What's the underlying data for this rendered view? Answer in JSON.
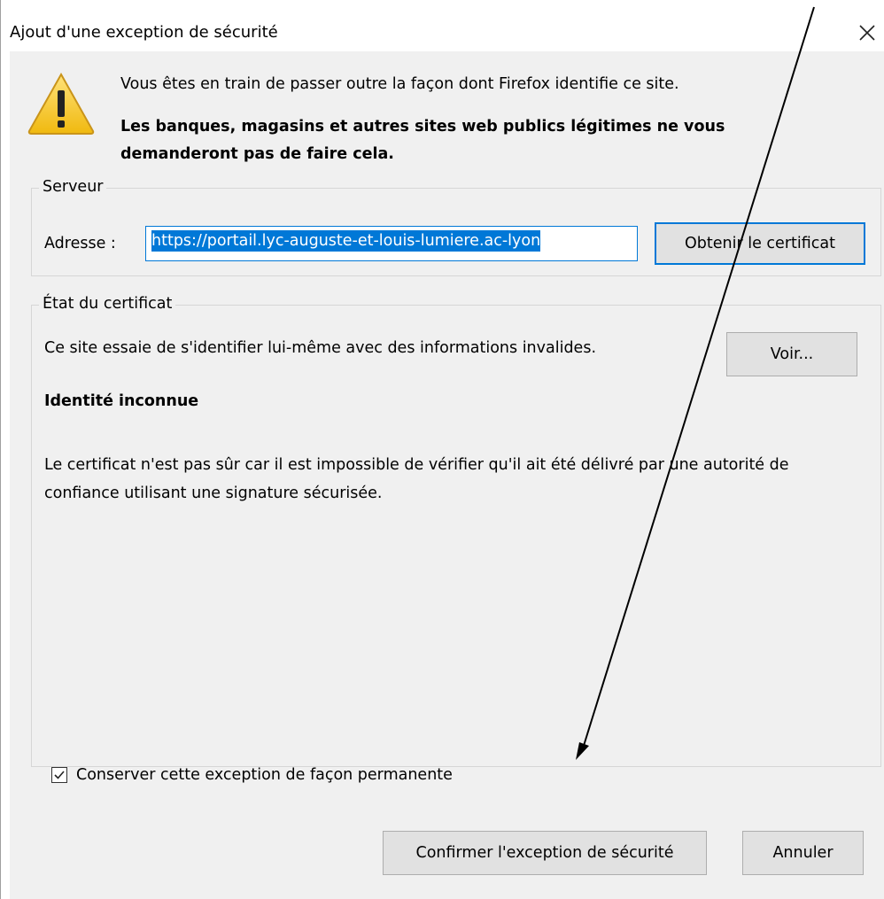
{
  "window": {
    "title": "Ajout d'une exception de sécurité",
    "close_icon": "close-icon"
  },
  "warning": {
    "icon": "warning-icon",
    "line1": "Vous êtes en train de passer outre la façon dont Firefox identifie ce site.",
    "line2": "Les banques, magasins et autres sites web publics légitimes ne vous demanderont pas de faire cela."
  },
  "server": {
    "legend": "Serveur",
    "address_label": "Adresse :",
    "address_value": "https://portail.lyc-auguste-et-louis-lumiere.ac-lyon",
    "get_cert_button": "Obtenir le certificat"
  },
  "cert_state": {
    "legend": "État du certificat",
    "status_text": "Ce site essaie de s'identifier lui-même avec des informations invalides.",
    "view_button": "Voir...",
    "identity_heading": "Identité inconnue",
    "description": "Le certificat n'est pas sûr car il est impossible de vérifier qu'il ait été délivré par une autorité de confiance utilisant une signature sécurisée.",
    "permanent_checkbox_label": "Conserver cette exception de façon permanente",
    "permanent_checked": true
  },
  "footer": {
    "confirm_button": "Confirmer l'exception de sécurité",
    "cancel_button": "Annuler"
  },
  "colors": {
    "accent": "#0078d7",
    "dialog_bg": "#f0f0f0",
    "button_bg": "#e1e1e1",
    "warning_yellow": "#f3c623"
  }
}
